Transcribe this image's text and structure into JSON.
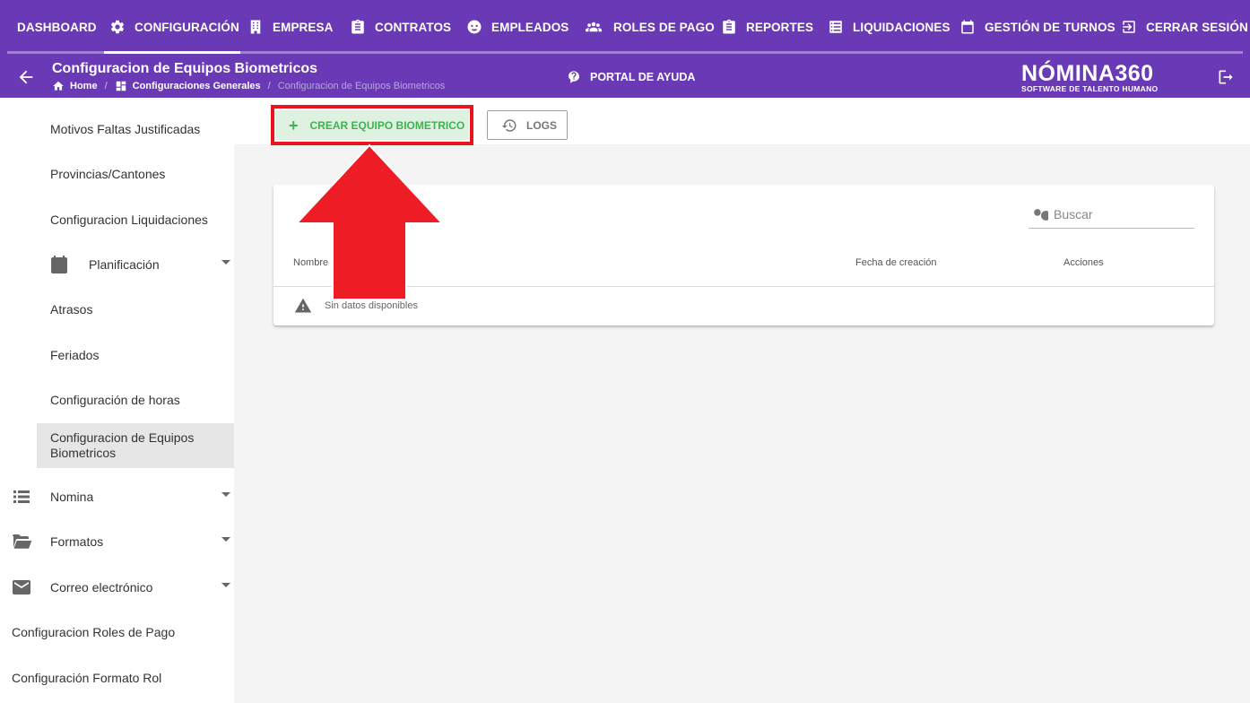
{
  "topnav": {
    "items": [
      {
        "label": "DASHBOARD",
        "icon": "none"
      },
      {
        "label": "CONFIGURACIÓN",
        "icon": "gear-icon"
      },
      {
        "label": "EMPRESA",
        "icon": "building-icon"
      },
      {
        "label": "CONTRATOS",
        "icon": "clipboard-icon"
      },
      {
        "label": "EMPLEADOS",
        "icon": "face-icon"
      },
      {
        "label": "ROLES DE PAGO",
        "icon": "people-icon"
      },
      {
        "label": "REPORTES",
        "icon": "clipboard-icon"
      },
      {
        "label": "LIQUIDACIONES",
        "icon": "list-icon"
      },
      {
        "label": "GESTIÓN DE TURNOS",
        "icon": "calendar-icon"
      },
      {
        "label": "CERRAR SESIÓN",
        "icon": "logout-icon"
      }
    ],
    "active": "CONFIGURACIÓN"
  },
  "header": {
    "title": "Configuracion de Equipos Biometricos",
    "breadcrumb": [
      "Home",
      "Configuraciones Generales",
      "Configuracion de Equipos Biometricos"
    ],
    "help_label": "PORTAL DE AYUDA",
    "brand_name": "NÓMINA360",
    "brand_tagline": "SOFTWARE DE TALENTO HUMANO"
  },
  "sidebar": {
    "items": [
      {
        "label": "Motivos Faltas Justificadas"
      },
      {
        "label": "Provincias/Cantones"
      },
      {
        "label": "Configuracion Liquidaciones"
      },
      {
        "label": "Planificación",
        "icon": "calendar-icon",
        "expandable": true
      },
      {
        "label": "Atrasos"
      },
      {
        "label": "Feriados"
      },
      {
        "label": "Configuración de horas"
      },
      {
        "label": "Configuracion de Equipos Biometricos",
        "active": true
      },
      {
        "label": "Nomina",
        "icon": "list-icon",
        "expandable": true
      },
      {
        "label": "Formatos",
        "icon": "folder-icon",
        "expandable": true
      },
      {
        "label": "Correo electrónico",
        "icon": "mail-icon",
        "expandable": true
      },
      {
        "label": "Configuracion Roles de Pago"
      },
      {
        "label": "Configuración Formato Rol"
      }
    ]
  },
  "toolbar": {
    "create_label": "CREAR EQUIPO BIOMETRICO",
    "logs_label": "LOGS"
  },
  "table": {
    "search_placeholder": "Buscar",
    "columns": [
      "Nombre",
      "Fecha de creación",
      "Acciones"
    ],
    "empty_message": "Sin datos disponibles"
  },
  "colors": {
    "primary": "#6a3ab6",
    "create_button_bg": "#dff2e1",
    "create_button_text": "#3db34f",
    "highlight": "#e8141e"
  }
}
